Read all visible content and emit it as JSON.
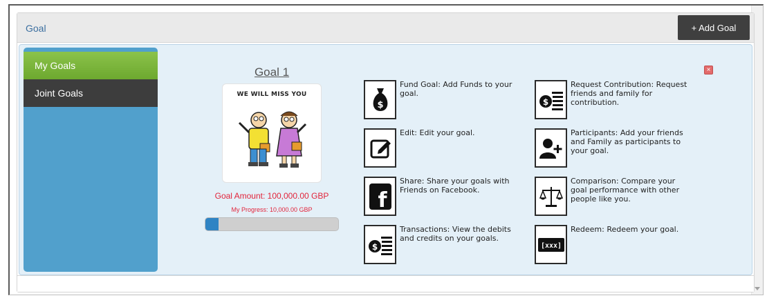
{
  "panel": {
    "title": "Goal",
    "add_button_label": "+ Add Goal"
  },
  "sidebar": {
    "items": [
      {
        "label": "My Goals"
      },
      {
        "label": "Joint Goals"
      }
    ]
  },
  "goal": {
    "name": "Goal 1",
    "image_caption": "WE WILL MISS YOU",
    "amount_text": "Goal Amount: 100,000.00 GBP",
    "progress_text": "My Progress: 10,000.00 GBP",
    "progress_fraction": 0.1
  },
  "actions": [
    {
      "text": "Fund Goal: Add Funds to your goal.",
      "icon": "money-bag-icon"
    },
    {
      "text": "Edit: Edit your goal.",
      "icon": "edit-icon"
    },
    {
      "text": "Share: Share your goals with Friends on Facebook.",
      "icon": "facebook-icon"
    },
    {
      "text": "Transactions: View the debits and credits on your goals.",
      "icon": "transactions-icon"
    },
    {
      "text": "Request Contribution: Request friends and family for contribution.",
      "icon": "request-contribution-icon"
    },
    {
      "text": "Participants: Add your friends and Family as participants to your goal.",
      "icon": "add-participant-icon"
    },
    {
      "text": "Comparison: Compare your goal performance with other people like you.",
      "icon": "scales-icon"
    },
    {
      "text": "Redeem: Redeem your goal.",
      "icon": "redeem-icon"
    }
  ],
  "colors": {
    "accent": "#51a0cc",
    "active": "#7cb83e",
    "alert": "#e2243b",
    "progress": "#2f84c4"
  }
}
